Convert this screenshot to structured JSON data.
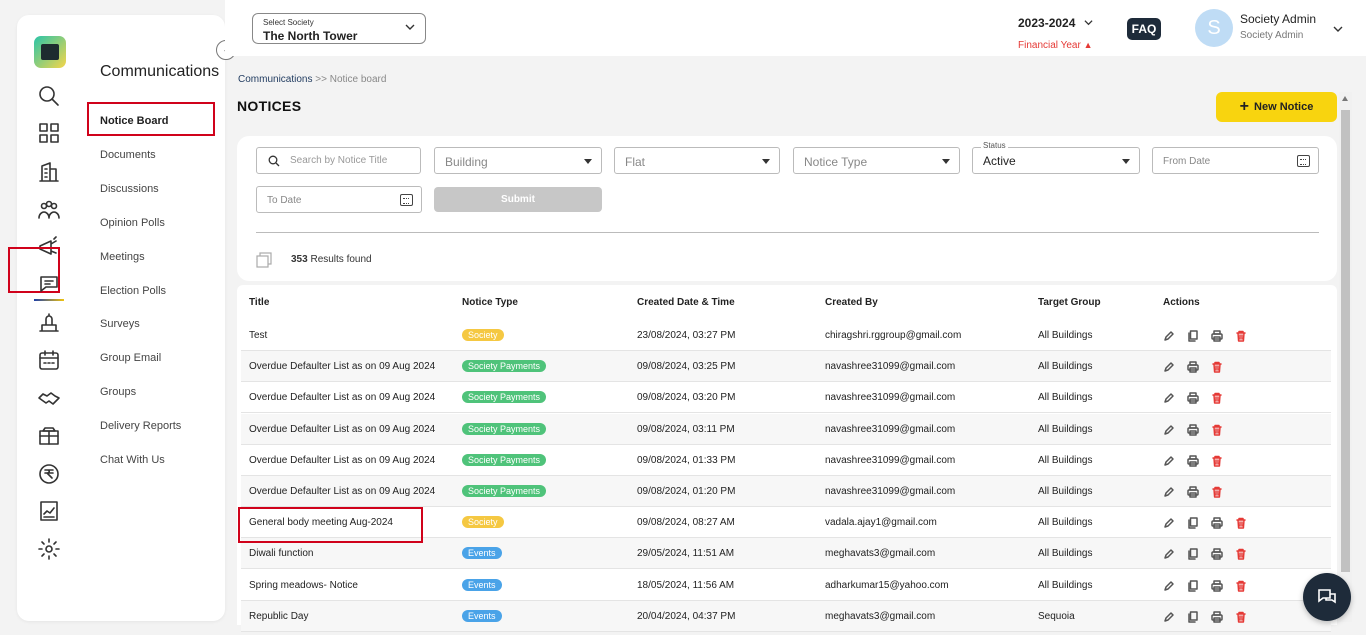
{
  "header": {
    "society_label": "Select Society",
    "society_value": "The North Tower",
    "financial_year": "2023-2024",
    "financial_year_label": "Financial Year",
    "faq": "FAQ",
    "avatar_initial": "S",
    "user_name": "Society Admin",
    "user_role": "Society Admin"
  },
  "subnav": {
    "title": "Communications",
    "items": [
      {
        "label": "Notice Board",
        "active": true
      },
      {
        "label": "Documents"
      },
      {
        "label": "Discussions"
      },
      {
        "label": "Opinion Polls"
      },
      {
        "label": "Meetings"
      },
      {
        "label": "Election Polls"
      },
      {
        "label": "Surveys"
      },
      {
        "label": "Group Email"
      },
      {
        "label": "Groups"
      },
      {
        "label": "Delivery Reports"
      },
      {
        "label": "Chat With Us"
      }
    ]
  },
  "rail": {
    "icons": [
      "search-icon",
      "dashboard-icon",
      "building-icon",
      "people-icon",
      "megaphone-icon",
      "communications-icon",
      "helpdesk-icon",
      "calendar-icon",
      "handshake-icon",
      "package-icon",
      "rupee-icon",
      "reports-icon",
      "settings-icon"
    ]
  },
  "breadcrumb": {
    "parent": "Communications",
    "sep": " >> ",
    "current": "Notice board"
  },
  "page": {
    "title": "NOTICES",
    "new_button": "New Notice"
  },
  "filters": {
    "search_placeholder": "Search by Notice Title",
    "building": "Building",
    "flat": "Flat",
    "notice_type": "Notice Type",
    "status_legend": "Status",
    "status_value": "Active",
    "from_date": "From Date",
    "to_date": "To Date",
    "submit": "Submit",
    "results_count": "353",
    "results_text": " Results found"
  },
  "table": {
    "headers": [
      "Title",
      "Notice Type",
      "Created Date & Time",
      "Created By",
      "Target Group",
      "Actions"
    ],
    "rows": [
      {
        "title": "Test",
        "type": "Society",
        "kind": "society",
        "date": "23/08/2024, 03:27 PM",
        "by": "chiragshri.rggroup@gmail.com",
        "target": "All Buildings",
        "actions": [
          "edit",
          "copy",
          "print",
          "delete"
        ]
      },
      {
        "title": "Overdue Defaulter List as on 09 Aug 2024",
        "type": "Society Payments",
        "kind": "payments",
        "date": "09/08/2024, 03:25 PM",
        "by": "navashree31099@gmail.com",
        "target": "All Buildings",
        "actions": [
          "edit",
          "print",
          "delete"
        ]
      },
      {
        "title": "Overdue Defaulter List as on 09 Aug 2024",
        "type": "Society Payments",
        "kind": "payments",
        "date": "09/08/2024, 03:20 PM",
        "by": "navashree31099@gmail.com",
        "target": "All Buildings",
        "actions": [
          "edit",
          "print",
          "delete"
        ]
      },
      {
        "title": "Overdue Defaulter List as on 09 Aug 2024",
        "type": "Society Payments",
        "kind": "payments",
        "date": "09/08/2024, 03:11 PM",
        "by": "navashree31099@gmail.com",
        "target": "All Buildings",
        "actions": [
          "edit",
          "print",
          "delete"
        ]
      },
      {
        "title": "Overdue Defaulter List as on 09 Aug 2024",
        "type": "Society Payments",
        "kind": "payments",
        "date": "09/08/2024, 01:33 PM",
        "by": "navashree31099@gmail.com",
        "target": "All Buildings",
        "actions": [
          "edit",
          "print",
          "delete"
        ]
      },
      {
        "title": "Overdue Defaulter List as on 09 Aug 2024",
        "type": "Society Payments",
        "kind": "payments",
        "date": "09/08/2024, 01:20 PM",
        "by": "navashree31099@gmail.com",
        "target": "All Buildings",
        "actions": [
          "edit",
          "print",
          "delete"
        ]
      },
      {
        "title": "General body meeting Aug-2024",
        "type": "Society",
        "kind": "society",
        "date": "09/08/2024, 08:27 AM",
        "by": "vadala.ajay1@gmail.com",
        "target": "All Buildings",
        "actions": [
          "edit",
          "copy",
          "print",
          "delete"
        ]
      },
      {
        "title": "Diwali function",
        "type": "Events",
        "kind": "events",
        "date": "29/05/2024, 11:51 AM",
        "by": "meghavats3@gmail.com",
        "target": "All Buildings",
        "actions": [
          "edit",
          "copy",
          "print",
          "delete"
        ]
      },
      {
        "title": "Spring meadows- Notice",
        "type": "Events",
        "kind": "events",
        "date": "18/05/2024, 11:56 AM",
        "by": "adharkumar15@yahoo.com",
        "target": "All Buildings",
        "actions": [
          "edit",
          "copy",
          "print",
          "delete"
        ]
      },
      {
        "title": "Republic Day",
        "type": "Events",
        "kind": "events",
        "date": "20/04/2024, 04:37 PM",
        "by": "meghavats3@gmail.com",
        "target": "Sequoia",
        "actions": [
          "edit",
          "copy",
          "print",
          "delete"
        ]
      }
    ]
  },
  "colors": {
    "accent": "#f8d40f",
    "highlight": "#d0021b",
    "society": "#f5c842",
    "payments": "#4fc37a",
    "events": "#4aa3e8",
    "dark": "#1e2b3a"
  }
}
